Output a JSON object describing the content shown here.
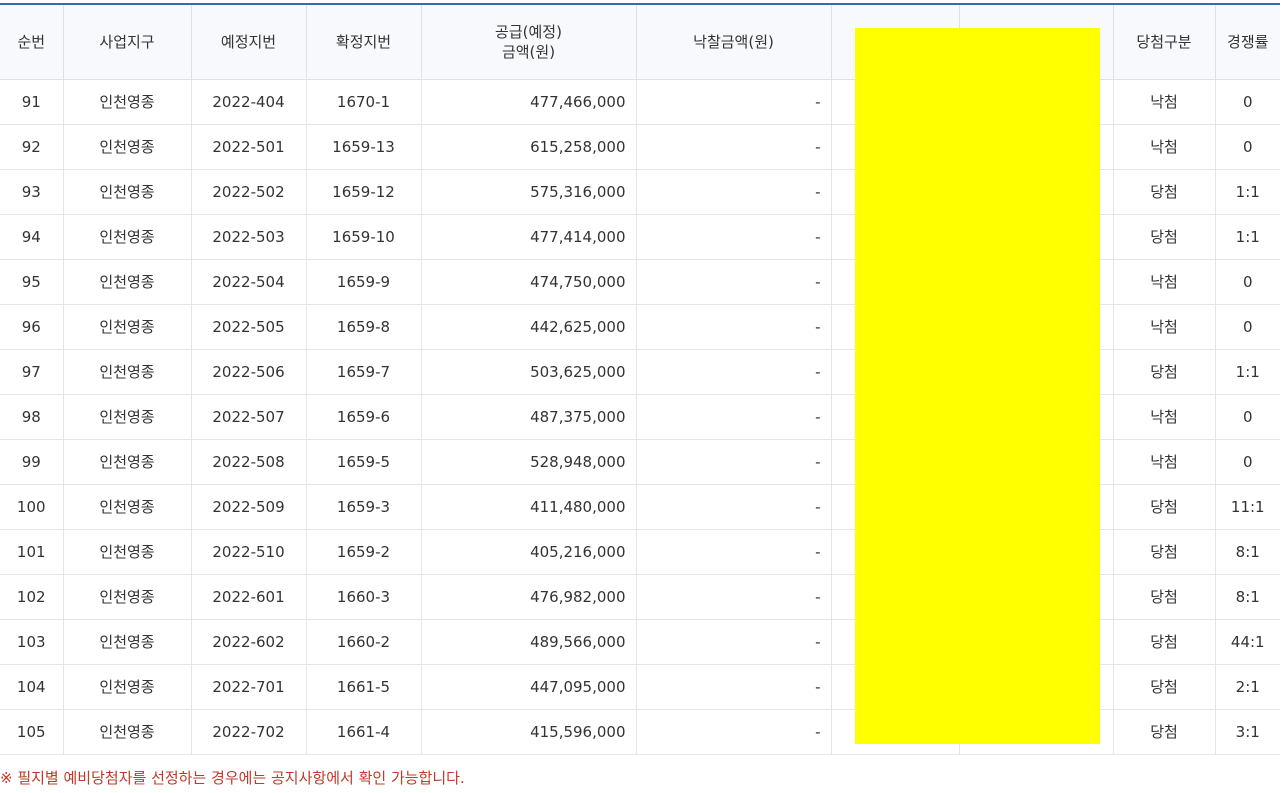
{
  "headers": {
    "seq": "순번",
    "district": "사업지구",
    "planned_lot": "예정지번",
    "confirmed_lot": "확정지번",
    "supply_line1": "공급(예정)",
    "supply_line2": "금액(원)",
    "bid_amount": "낙찰금액(원)",
    "col7": "",
    "col8": "",
    "result": "당첨구분",
    "ratio": "경쟁률"
  },
  "rows": [
    {
      "seq": "91",
      "district": "인천영종",
      "planned": "2022-404",
      "confirmed": "1670-1",
      "supply": "477,466,000",
      "bid": "-",
      "result": "낙첨",
      "ratio": "0"
    },
    {
      "seq": "92",
      "district": "인천영종",
      "planned": "2022-501",
      "confirmed": "1659-13",
      "supply": "615,258,000",
      "bid": "-",
      "result": "낙첨",
      "ratio": "0"
    },
    {
      "seq": "93",
      "district": "인천영종",
      "planned": "2022-502",
      "confirmed": "1659-12",
      "supply": "575,316,000",
      "bid": "-",
      "result": "당첨",
      "ratio": "1:1"
    },
    {
      "seq": "94",
      "district": "인천영종",
      "planned": "2022-503",
      "confirmed": "1659-10",
      "supply": "477,414,000",
      "bid": "-",
      "result": "당첨",
      "ratio": "1:1"
    },
    {
      "seq": "95",
      "district": "인천영종",
      "planned": "2022-504",
      "confirmed": "1659-9",
      "supply": "474,750,000",
      "bid": "-",
      "result": "낙첨",
      "ratio": "0"
    },
    {
      "seq": "96",
      "district": "인천영종",
      "planned": "2022-505",
      "confirmed": "1659-8",
      "supply": "442,625,000",
      "bid": "-",
      "result": "낙첨",
      "ratio": "0"
    },
    {
      "seq": "97",
      "district": "인천영종",
      "planned": "2022-506",
      "confirmed": "1659-7",
      "supply": "503,625,000",
      "bid": "-",
      "result": "당첨",
      "ratio": "1:1"
    },
    {
      "seq": "98",
      "district": "인천영종",
      "planned": "2022-507",
      "confirmed": "1659-6",
      "supply": "487,375,000",
      "bid": "-",
      "result": "낙첨",
      "ratio": "0"
    },
    {
      "seq": "99",
      "district": "인천영종",
      "planned": "2022-508",
      "confirmed": "1659-5",
      "supply": "528,948,000",
      "bid": "-",
      "result": "낙첨",
      "ratio": "0"
    },
    {
      "seq": "100",
      "district": "인천영종",
      "planned": "2022-509",
      "confirmed": "1659-3",
      "supply": "411,480,000",
      "bid": "-",
      "result": "당첨",
      "ratio": "11:1"
    },
    {
      "seq": "101",
      "district": "인천영종",
      "planned": "2022-510",
      "confirmed": "1659-2",
      "supply": "405,216,000",
      "bid": "-",
      "result": "당첨",
      "ratio": "8:1"
    },
    {
      "seq": "102",
      "district": "인천영종",
      "planned": "2022-601",
      "confirmed": "1660-3",
      "supply": "476,982,000",
      "bid": "-",
      "result": "당첨",
      "ratio": "8:1"
    },
    {
      "seq": "103",
      "district": "인천영종",
      "planned": "2022-602",
      "confirmed": "1660-2",
      "supply": "489,566,000",
      "bid": "-",
      "result": "당첨",
      "ratio": "44:1"
    },
    {
      "seq": "104",
      "district": "인천영종",
      "planned": "2022-701",
      "confirmed": "1661-5",
      "supply": "447,095,000",
      "bid": "-",
      "result": "당첨",
      "ratio": "2:1"
    },
    {
      "seq": "105",
      "district": "인천영종",
      "planned": "2022-702",
      "confirmed": "1661-4",
      "supply": "415,596,000",
      "bid": "-",
      "result": "당첨",
      "ratio": "3:1"
    }
  ],
  "notice": "※ 필지별 예비당첨자를 선정하는 경우에는 공지사항에서 확인 가능합니다.",
  "colors": {
    "accent_border": "#3b6aa8",
    "redaction": "#ffff00",
    "notice_text": "#c0392b"
  }
}
